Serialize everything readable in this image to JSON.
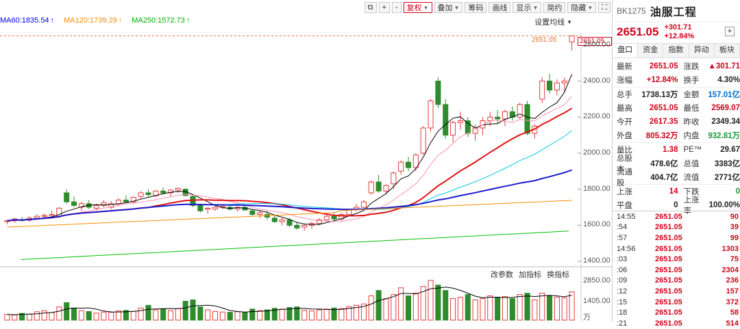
{
  "toolbar": {
    "buttons": [
      {
        "label": "",
        "icon": "copy-icon"
      },
      {
        "label": "+",
        "icon": ""
      },
      {
        "label": "-",
        "icon": ""
      },
      {
        "label": "复权",
        "caret": true,
        "active": true
      },
      {
        "label": "叠加",
        "caret": true
      },
      {
        "label": "筹码",
        "caret": false
      },
      {
        "label": "画线",
        "caret": false
      },
      {
        "label": "显示",
        "caret": true
      },
      {
        "label": "简约",
        "caret": false
      },
      {
        "label": "隐藏",
        "caret": true
      },
      {
        "label": "",
        "icon": "fullscreen-icon"
      }
    ]
  },
  "ma_legend": [
    {
      "label": "MA60:1835.54",
      "color": "#0000ff"
    },
    {
      "label": "MA120:1739.29",
      "color": "#ff8c00"
    },
    {
      "label": "MA250:1572.73",
      "color": "#00b000"
    }
  ],
  "settings_label": "设置均线",
  "price_axis": {
    "ticks": [
      "2651.05",
      "2600.00",
      "2400.00",
      "2200.00",
      "2000.00",
      "1800.00",
      "1600.00",
      "1400.00"
    ],
    "current_price_text": "2651.05"
  },
  "volume_panel": {
    "buttons": [
      "改参数",
      "加指标",
      "换指标"
    ],
    "ticks": [
      "2850.00",
      "1405.00",
      "万"
    ]
  },
  "chart_data": {
    "type": "candlestick",
    "ylim": [
      1370,
      2660
    ],
    "candles": [
      [
        1620,
        1630,
        1605,
        1625
      ],
      [
        1625,
        1640,
        1615,
        1635
      ],
      [
        1630,
        1645,
        1620,
        1628
      ],
      [
        1628,
        1650,
        1620,
        1640
      ],
      [
        1640,
        1660,
        1630,
        1650
      ],
      [
        1650,
        1665,
        1640,
        1655
      ],
      [
        1655,
        1680,
        1645,
        1660
      ],
      [
        1650,
        1700,
        1640,
        1695
      ],
      [
        1780,
        1800,
        1720,
        1730
      ],
      [
        1730,
        1760,
        1700,
        1710
      ],
      [
        1700,
        1730,
        1680,
        1720
      ],
      [
        1720,
        1740,
        1690,
        1700
      ],
      [
        1695,
        1720,
        1680,
        1710
      ],
      [
        1710,
        1740,
        1700,
        1725
      ],
      [
        1700,
        1735,
        1690,
        1720
      ],
      [
        1720,
        1750,
        1705,
        1740
      ],
      [
        1740,
        1765,
        1725,
        1730
      ],
      [
        1730,
        1760,
        1720,
        1755
      ],
      [
        1760,
        1790,
        1745,
        1780
      ],
      [
        1780,
        1800,
        1760,
        1770
      ],
      [
        1765,
        1795,
        1755,
        1790
      ],
      [
        1790,
        1810,
        1770,
        1780
      ],
      [
        1780,
        1800,
        1760,
        1795
      ],
      [
        1795,
        1810,
        1780,
        1805
      ],
      [
        1800,
        1805,
        1760,
        1765
      ],
      [
        1760,
        1770,
        1700,
        1710
      ],
      [
        1710,
        1720,
        1670,
        1680
      ],
      [
        1690,
        1700,
        1665,
        1695
      ],
      [
        1690,
        1710,
        1680,
        1700
      ],
      [
        1700,
        1715,
        1690,
        1705
      ],
      [
        1700,
        1710,
        1680,
        1690
      ],
      [
        1690,
        1705,
        1675,
        1700
      ],
      [
        1700,
        1710,
        1680,
        1685
      ],
      [
        1680,
        1690,
        1650,
        1660
      ],
      [
        1660,
        1680,
        1640,
        1670
      ],
      [
        1660,
        1680,
        1630,
        1645
      ],
      [
        1640,
        1660,
        1615,
        1620
      ],
      [
        1620,
        1640,
        1600,
        1630
      ],
      [
        1630,
        1640,
        1590,
        1600
      ],
      [
        1600,
        1620,
        1575,
        1585
      ],
      [
        1590,
        1610,
        1570,
        1600
      ],
      [
        1600,
        1620,
        1580,
        1610
      ],
      [
        1610,
        1640,
        1600,
        1630
      ],
      [
        1630,
        1660,
        1620,
        1650
      ],
      [
        1650,
        1670,
        1620,
        1635
      ],
      [
        1635,
        1670,
        1625,
        1660
      ],
      [
        1660,
        1690,
        1650,
        1685
      ],
      [
        1690,
        1720,
        1680,
        1700
      ],
      [
        1700,
        1740,
        1690,
        1730
      ],
      [
        1780,
        1850,
        1770,
        1840
      ],
      [
        1840,
        1880,
        1780,
        1790
      ],
      [
        1790,
        1830,
        1770,
        1820
      ],
      [
        1830,
        1900,
        1800,
        1890
      ],
      [
        1900,
        1960,
        1880,
        1950
      ],
      [
        1950,
        1980,
        1900,
        1920
      ],
      [
        1920,
        2000,
        1900,
        1990
      ],
      [
        2000,
        2150,
        1990,
        2140
      ],
      [
        2140,
        2300,
        2120,
        2290
      ],
      [
        2400,
        2420,
        2250,
        2270
      ],
      [
        2270,
        2300,
        2080,
        2100
      ],
      [
        2100,
        2180,
        2060,
        2170
      ],
      [
        2170,
        2230,
        2130,
        2180
      ],
      [
        2180,
        2200,
        2090,
        2110
      ],
      [
        2110,
        2160,
        2070,
        2140
      ],
      [
        2140,
        2200,
        2100,
        2180
      ],
      [
        2180,
        2230,
        2150,
        2200
      ],
      [
        2200,
        2240,
        2160,
        2190
      ],
      [
        2190,
        2240,
        2150,
        2230
      ],
      [
        2230,
        2260,
        2180,
        2200
      ],
      [
        2200,
        2280,
        2190,
        2270
      ],
      [
        2270,
        2290,
        2100,
        2110
      ],
      [
        2110,
        2160,
        2080,
        2150
      ],
      [
        2300,
        2420,
        2280,
        2400
      ],
      [
        2400,
        2440,
        2330,
        2350
      ],
      [
        2350,
        2410,
        2320,
        2390
      ],
      [
        2390,
        2420,
        2340,
        2400
      ],
      [
        2617.35,
        2651.05,
        2569.07,
        2651.05
      ]
    ],
    "ma_lines": [
      "MA5",
      "MA10",
      "MA20",
      "MA30",
      "MA60",
      "MA120",
      "MA250"
    ],
    "volume_ylim": [
      0,
      3200
    ],
    "volume": [
      420,
      380,
      500,
      450,
      620,
      700,
      560,
      980,
      1300,
      900,
      700,
      640,
      520,
      600,
      580,
      680,
      720,
      650,
      900,
      1100,
      760,
      820,
      700,
      860,
      1400,
      1500,
      980,
      760,
      640,
      600,
      580,
      620,
      560,
      820,
      700,
      760,
      880,
      820,
      940,
      980,
      720,
      680,
      760,
      820,
      900,
      860,
      1000,
      1100,
      1200,
      1800,
      2200,
      1600,
      1900,
      2400,
      1800,
      2000,
      2500,
      2950,
      2600,
      2200,
      1600,
      1700,
      1900,
      1500,
      1600,
      1800,
      1700,
      1750,
      1600,
      1900,
      2000,
      1500,
      2000,
      1800,
      1700,
      1650,
      2100
    ]
  },
  "side": {
    "code": "BK1275",
    "name": "油服工程",
    "price": "2651.05",
    "change": "+301.71",
    "change_pct": "+12.84%",
    "tabs": [
      "盘口",
      "资金",
      "指数",
      "异动",
      "板块"
    ],
    "quote_rows": [
      {
        "l1": "最新",
        "v1": "2651.05",
        "c1": "red",
        "l2": "涨跌",
        "v2": "▲301.71",
        "c2": "red"
      },
      {
        "l1": "涨幅",
        "v1": "+12.84%",
        "c1": "red",
        "l2": "换手",
        "v2": "4.30%",
        "c2": "black"
      },
      {
        "l1": "总手",
        "v1": "1738.13万",
        "c1": "black",
        "l2": "金额",
        "v2": "157.01亿",
        "c2": "blue"
      },
      {
        "l1": "最高",
        "v1": "2651.05",
        "c1": "red",
        "l2": "最低",
        "v2": "2569.07",
        "c2": "red"
      },
      {
        "l1": "今开",
        "v1": "2617.35",
        "c1": "red",
        "l2": "昨收",
        "v2": "2349.34",
        "c2": "black"
      },
      {
        "l1": "外盘",
        "v1": "805.32万",
        "c1": "red",
        "l2": "内盘",
        "v2": "932.81万",
        "c2": "green"
      },
      {
        "l1": "量比",
        "v1": "1.38",
        "c1": "red",
        "l2": "PE™",
        "v2": "29.67",
        "c2": "black"
      },
      {
        "l1": "总股本",
        "v1": "478.6亿",
        "c1": "black",
        "l2": "总值",
        "v2": "3383亿",
        "c2": "black"
      },
      {
        "l1": "流通股",
        "v1": "404.7亿",
        "c1": "black",
        "l2": "流值",
        "v2": "2771亿",
        "c2": "black"
      },
      {
        "l1": "上涨",
        "v1": "14",
        "c1": "red",
        "l2": "下跌",
        "v2": "0",
        "c2": "green"
      },
      {
        "l1": "平盘",
        "v1": "0",
        "c1": "black",
        "l2": "上涨率",
        "v2": "100.00%",
        "c2": "black"
      }
    ],
    "ticks": [
      {
        "time": "14:55",
        "price": "2651.05",
        "vol": "90"
      },
      {
        "time": ":54",
        "price": "2651.05",
        "vol": "39"
      },
      {
        "time": ":57",
        "price": "2651.05",
        "vol": "99"
      },
      {
        "time": "14:56",
        "price": "2651.05",
        "vol": "1303"
      },
      {
        "time": ":03",
        "price": "2651.05",
        "vol": "75"
      },
      {
        "time": ":06",
        "price": "2651.05",
        "vol": "2304"
      },
      {
        "time": ":09",
        "price": "2651.05",
        "vol": "236"
      },
      {
        "time": ":12",
        "price": "2651.05",
        "vol": "157"
      },
      {
        "time": ":15",
        "price": "2651.05",
        "vol": "372"
      },
      {
        "time": ":18",
        "price": "2651.05",
        "vol": "58"
      },
      {
        "time": ":21",
        "price": "2651.05",
        "vol": "514"
      }
    ]
  }
}
